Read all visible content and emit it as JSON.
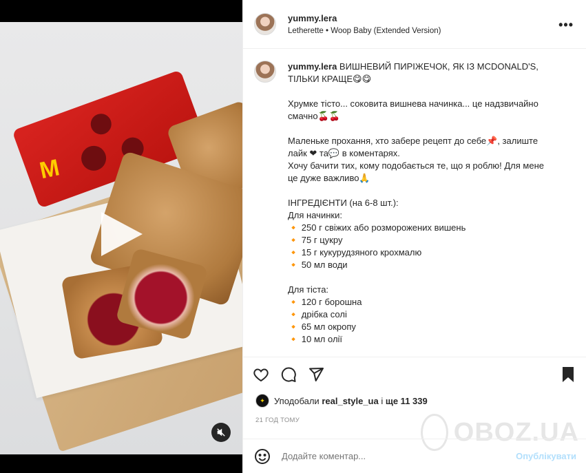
{
  "post": {
    "username": "yummy.lera",
    "audio": "Letherette • Woop Baby (Extended Version)"
  },
  "caption": {
    "username": "yummy.lera",
    "title_lines": [
      "ВИШНЕВИЙ ПИРІЖЕЧОК, ЯК ІЗ MCDONALD'S,",
      "ТІЛЬКИ КРАЩЕ😋😋"
    ],
    "para1": [
      "Хрумке тісто... соковита вишнева начинка... це надзвичайно",
      "смачно🍒🍒"
    ],
    "para2": [
      "Маленьке прохання, хто забере рецепт до себе📌, залиште",
      "лайк ❤ та💬 в коментарях.",
      "Хочу бачити тих, кому подобається те, що я роблю! Для мене",
      "це дуже важливо🙏"
    ],
    "ingredients_title": "ІНГРЕДІЄНТИ (на 6-8 шт.):",
    "filling_title": "Для начинки:",
    "filling": [
      "🔸 250 г свіжих або розморожених вишень",
      "🔸 75 г цукру",
      "🔸 15 г кукурудзяного крохмалю",
      "🔸 50 мл води"
    ],
    "dough_title": "Для тіста:",
    "dough": [
      "🔸 120 г борошна",
      "🔸 дрібка солі",
      "🔸 65 мл окропу",
      "🔸 10 мл олії"
    ]
  },
  "likes": {
    "prefix": "Уподобали",
    "user": "real_style_ua",
    "middle": "і",
    "count": "ще 11 339"
  },
  "timestamp": "21 ГОД ТОМУ",
  "comment": {
    "placeholder": "Додайте коментар...",
    "post_label": "Опублікувати"
  },
  "watermark": "OBOZ.UA",
  "icons": [
    "more-icon",
    "heart-icon",
    "comment-icon",
    "share-icon",
    "bookmark-icon",
    "emoji-icon",
    "play-icon",
    "mute-icon"
  ],
  "colors": {
    "post_button": "#b2dffc",
    "text": "#262626",
    "muted": "#8e8e8e"
  }
}
